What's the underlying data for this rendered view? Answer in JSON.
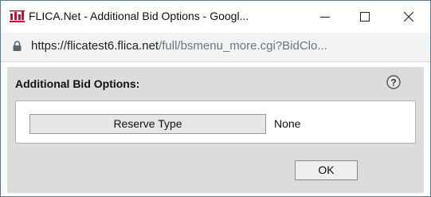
{
  "window": {
    "title": "FLICA.Net - Additional Bid Options - Googl...",
    "controls": {
      "minimize": "—",
      "maximize": "☐",
      "close": "✕"
    },
    "logo_text": "FLICA"
  },
  "address_bar": {
    "host": "https://flicatest6.flica.net",
    "path": "/full/bsmenu_more.cgi?BidClo..."
  },
  "dialog": {
    "heading": "Additional Bid Options:",
    "help_icon": "question-circle-icon",
    "reserve_type": {
      "button_label": "Reserve Type",
      "value": "None"
    },
    "ok_label": "OK"
  },
  "colors": {
    "content_bg": "#dcdcdc",
    "logo_red": "#c8102e",
    "frame": "#4f6f8f"
  }
}
